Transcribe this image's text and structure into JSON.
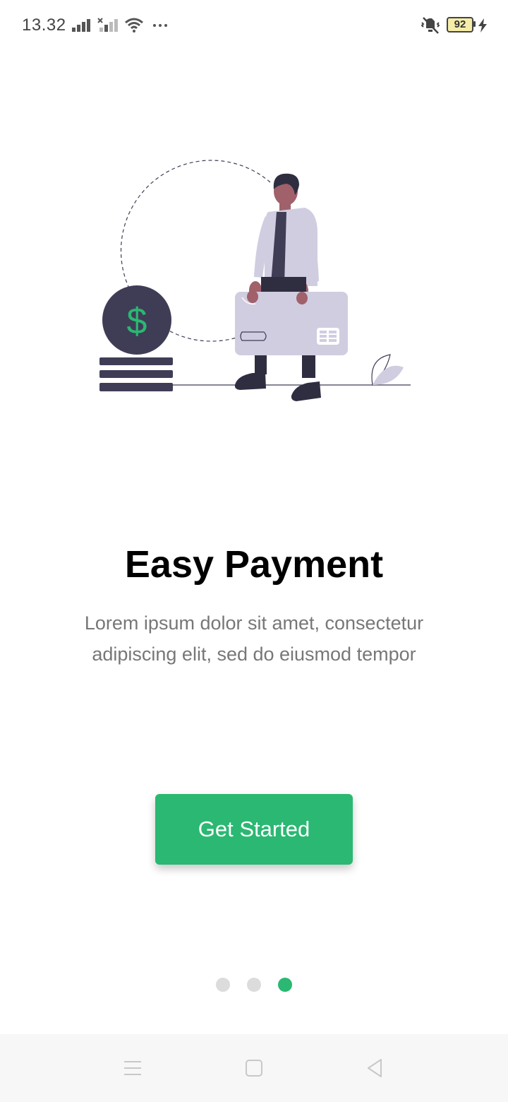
{
  "status_bar": {
    "time": "13.32",
    "battery_level": "92",
    "icons": [
      "signal-icon",
      "signal-no-sim-icon",
      "wifi-icon",
      "more-notifications-icon",
      "vibrate-mute-icon",
      "battery-icon",
      "charging-icon"
    ]
  },
  "onboarding": {
    "title": "Easy Payment",
    "description": "Lorem ipsum dolor sit amet, consectetur adipiscing elit, sed do eiusmod tempor",
    "button_label": "Get Started",
    "page_count": 3,
    "active_page": 3
  },
  "colors": {
    "accent": "#2ab872",
    "dark": "#3f3d56",
    "card": "#d0cde1",
    "skin": "#a0616a",
    "inactive_dot": "#dcdcdc",
    "subtitle": "#777777"
  },
  "nav_bar": {
    "icons": [
      "menu-icon",
      "home-icon",
      "back-icon"
    ]
  }
}
